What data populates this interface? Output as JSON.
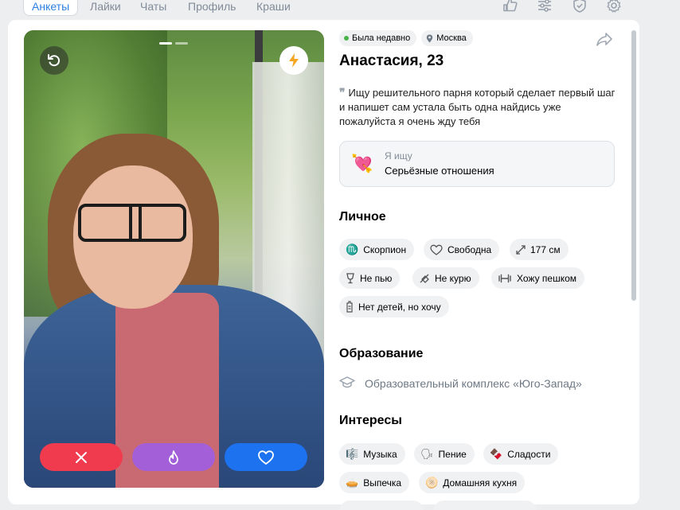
{
  "nav": {
    "tabs": [
      {
        "label": "Анкеты",
        "active": true
      },
      {
        "label": "Лайки"
      },
      {
        "label": "Чаты"
      },
      {
        "label": "Профиль"
      },
      {
        "label": "Краши"
      }
    ],
    "icons": [
      "thumbs-up-icon",
      "filters-icon",
      "shield-check-icon",
      "gear-icon"
    ]
  },
  "photo": {
    "buttons": [
      "undo-icon",
      "boost-icon"
    ],
    "actions": [
      "dislike",
      "super-like",
      "like"
    ],
    "colors": {
      "dislike": "#ef3b4d",
      "super": "#a35fd8",
      "like": "#1d72f0"
    }
  },
  "profile": {
    "status": "Была недавно",
    "city": "Москва",
    "name": "Анастасия, 23",
    "bio": "Ищу решительного парня который сделает первый шаг и напишет сам устала быть одна найдись уже пожалуйста я очень жду тебя",
    "seeking": {
      "label": "Я ищу",
      "value": "Серьёзные отношения"
    },
    "personal": {
      "title": "Личное",
      "chips": [
        "Скорпион",
        "Свободна",
        "177 см",
        "Не пью",
        "Не курю",
        "Хожу пешком",
        "Нет детей, но хочу"
      ]
    },
    "education": {
      "title": "Образование",
      "value": "Образовательный комплекс «Юго-Запад»"
    },
    "interests": {
      "title": "Интересы",
      "chips": [
        "Музыка",
        "Пение",
        "Сладости",
        "Выпечка",
        "Домашняя кухня"
      ]
    }
  }
}
